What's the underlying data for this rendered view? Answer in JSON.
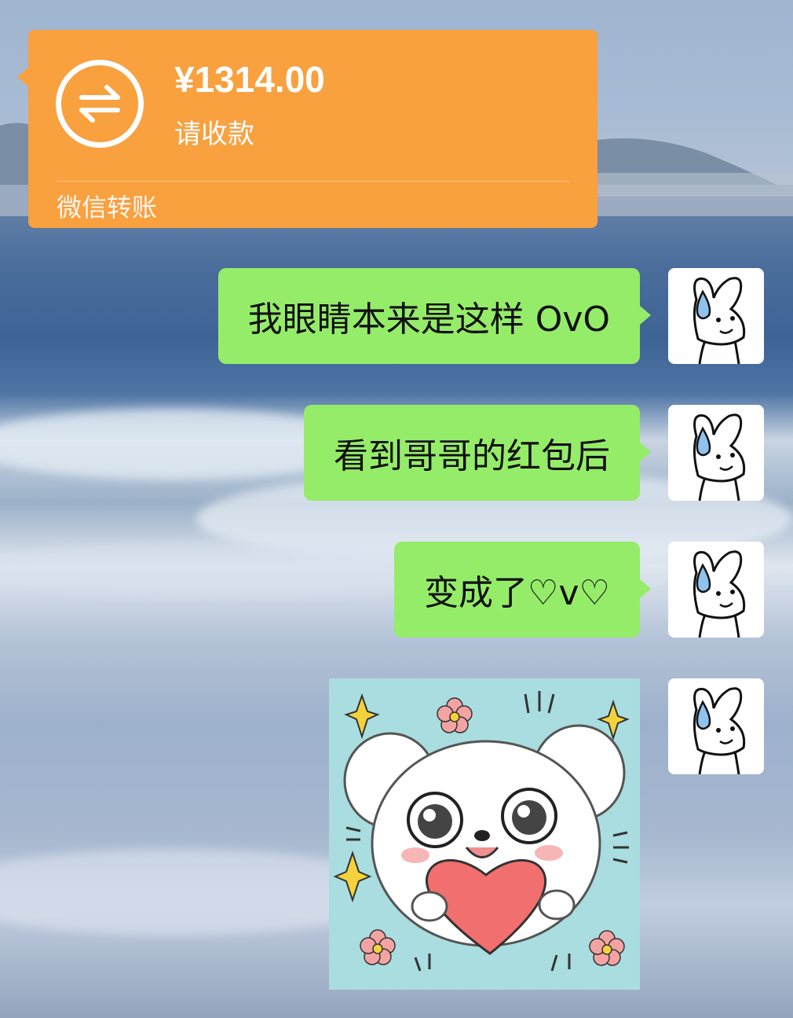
{
  "transfer": {
    "amount": "¥1314.00",
    "subtitle": "请收款",
    "footer": "微信转账",
    "icon": "transfer-arrows-icon",
    "color": "#f9a03f"
  },
  "messages": [
    {
      "text": "我眼睛本来是这样 OvO"
    },
    {
      "text": "看到哥哥的红包后"
    },
    {
      "text": "变成了♡v♡"
    }
  ],
  "sticker": {
    "name": "puppy-heart-sticker"
  },
  "avatar": {
    "name": "bunny-avatar-icon"
  },
  "colors": {
    "bubble": "#95ec69",
    "transfer": "#f9a03f"
  }
}
